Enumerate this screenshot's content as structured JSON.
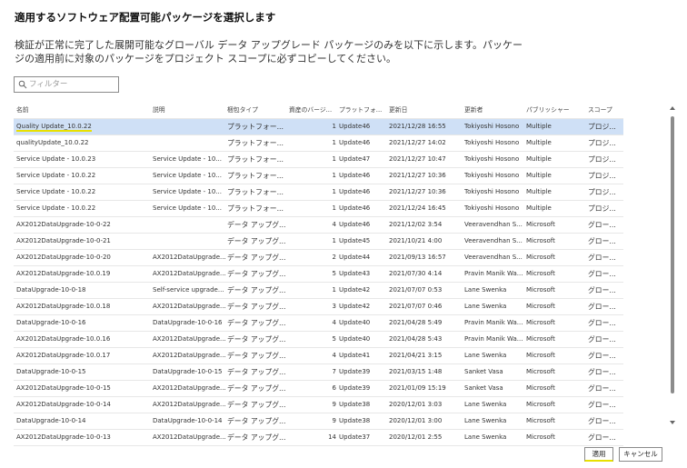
{
  "dialog": {
    "title": "適用するソフトウェア配置可能パッケージを選択します",
    "description": "検証が正常に完了した展開可能なグローバル データ アップグレード パッケージのみを以下に示します。パッケージの適用前に対象のパッケージをプロジェクト スコープに必ずコピーしてください。"
  },
  "filter": {
    "placeholder": "フィルター"
  },
  "table": {
    "headers": {
      "name": "名前",
      "desc": "説明",
      "type": "梱包タイプ",
      "count": "資産のバージ...",
      "platform": "プラットフォ...",
      "updated": "更新日",
      "updated_by": "更新者",
      "publisher": "パブリッシャー",
      "scope": "スコープ"
    },
    "rows": [
      {
        "name": "Quality Update_10.0.22",
        "desc": "",
        "type": "プラットフォー...",
        "count": "1",
        "platform": "Update46",
        "updated": "2021/12/28 16:55",
        "updated_by": "Tokiyoshi Hosono",
        "publisher": "Multiple",
        "scope": "プロジ..."
      },
      {
        "name": "qualityUpdate_10.0.22",
        "desc": "",
        "type": "プラットフォー...",
        "count": "1",
        "platform": "Update46",
        "updated": "2021/12/27 14:02",
        "updated_by": "Tokiyoshi Hosono",
        "publisher": "Multiple",
        "scope": "プロジ..."
      },
      {
        "name": "Service Update - 10.0.23",
        "desc": "Service Update - 10...",
        "type": "プラットフォー...",
        "count": "1",
        "platform": "Update47",
        "updated": "2021/12/27 10:47",
        "updated_by": "Tokiyoshi Hosono",
        "publisher": "Multiple",
        "scope": "プロジ..."
      },
      {
        "name": "Service Update - 10.0.22",
        "desc": "Service Update - 10...",
        "type": "プラットフォー...",
        "count": "1",
        "platform": "Update46",
        "updated": "2021/12/27 10:36",
        "updated_by": "Tokiyoshi Hosono",
        "publisher": "Multiple",
        "scope": "プロジ..."
      },
      {
        "name": "Service Update - 10.0.22",
        "desc": "Service Update - 10...",
        "type": "プラットフォー...",
        "count": "1",
        "platform": "Update46",
        "updated": "2021/12/27 10:36",
        "updated_by": "Tokiyoshi Hosono",
        "publisher": "Multiple",
        "scope": "プロジ..."
      },
      {
        "name": "Service Update - 10.0.22",
        "desc": "Service Update - 10...",
        "type": "プラットフォー...",
        "count": "1",
        "platform": "Update46",
        "updated": "2021/12/24 16:45",
        "updated_by": "Tokiyoshi Hosono",
        "publisher": "Multiple",
        "scope": "プロジ..."
      },
      {
        "name": "AX2012DataUpgrade-10-0-22",
        "desc": "",
        "type": "データ アップグ...",
        "count": "4",
        "platform": "Update46",
        "updated": "2021/12/02 3:54",
        "updated_by": "Veeravendhan S...",
        "publisher": "Microsoft",
        "scope": "グロー..."
      },
      {
        "name": "AX2012DataUpgrade-10-0-21",
        "desc": "",
        "type": "データ アップグ...",
        "count": "1",
        "platform": "Update45",
        "updated": "2021/10/21 4:00",
        "updated_by": "Veeravendhan S...",
        "publisher": "Microsoft",
        "scope": "グロー..."
      },
      {
        "name": "AX2012DataUpgrade-10-0-20",
        "desc": "AX2012DataUpgrade...",
        "type": "データ アップグ...",
        "count": "2",
        "platform": "Update44",
        "updated": "2021/09/13 16:57",
        "updated_by": "Veeravendhan S...",
        "publisher": "Microsoft",
        "scope": "グロー..."
      },
      {
        "name": "AX2012DataUpgrade-10.0.19",
        "desc": "AX2012DataUpgrade...",
        "type": "データ アップグ...",
        "count": "5",
        "platform": "Update43",
        "updated": "2021/07/30 4:14",
        "updated_by": "Pravin Manik Wa...",
        "publisher": "Microsoft",
        "scope": "グロー..."
      },
      {
        "name": "DataUpgrade-10-0-18",
        "desc": "Self-service upgrade...",
        "type": "データ アップグ...",
        "count": "1",
        "platform": "Update42",
        "updated": "2021/07/07 0:53",
        "updated_by": "Lane Swenka",
        "publisher": "Microsoft",
        "scope": "グロー..."
      },
      {
        "name": "AX2012DataUpgrade-10.0.18",
        "desc": "AX2012DataUpgrade...",
        "type": "データ アップグ...",
        "count": "3",
        "platform": "Update42",
        "updated": "2021/07/07 0:46",
        "updated_by": "Lane Swenka",
        "publisher": "Microsoft",
        "scope": "グロー..."
      },
      {
        "name": "DataUpgrade-10-0-16",
        "desc": "DataUpgrade-10-0-16",
        "type": "データ アップグ...",
        "count": "4",
        "platform": "Update40",
        "updated": "2021/04/28 5:49",
        "updated_by": "Pravin Manik Wa...",
        "publisher": "Microsoft",
        "scope": "グロー..."
      },
      {
        "name": "AX2012DataUpgrade-10.0.16",
        "desc": "AX2012DataUpgrade...",
        "type": "データ アップグ...",
        "count": "5",
        "platform": "Update40",
        "updated": "2021/04/28 5:43",
        "updated_by": "Pravin Manik Wa...",
        "publisher": "Microsoft",
        "scope": "グロー..."
      },
      {
        "name": "AX2012DataUpgrade-10.0.17",
        "desc": "AX2012DataUpgrade...",
        "type": "データ アップグ...",
        "count": "4",
        "platform": "Update41",
        "updated": "2021/04/21 3:15",
        "updated_by": "Lane Swenka",
        "publisher": "Microsoft",
        "scope": "グロー..."
      },
      {
        "name": "DataUpgrade-10-0-15",
        "desc": "DataUpgrade-10-0-15",
        "type": "データ アップグ...",
        "count": "7",
        "platform": "Update39",
        "updated": "2021/03/15 1:48",
        "updated_by": "Sanket Vasa",
        "publisher": "Microsoft",
        "scope": "グロー..."
      },
      {
        "name": "AX2012DataUpgrade-10-0-15",
        "desc": "AX2012DataUpgrade...",
        "type": "データ アップグ...",
        "count": "6",
        "platform": "Update39",
        "updated": "2021/01/09 15:19",
        "updated_by": "Sanket Vasa",
        "publisher": "Microsoft",
        "scope": "グロー..."
      },
      {
        "name": "AX2012DataUpgrade-10-0-14",
        "desc": "AX2012DataUpgrade...",
        "type": "データ アップグ...",
        "count": "9",
        "platform": "Update38",
        "updated": "2020/12/01 3:03",
        "updated_by": "Lane Swenka",
        "publisher": "Microsoft",
        "scope": "グロー..."
      },
      {
        "name": "DataUpgrade-10-0-14",
        "desc": "DataUpgrade-10-0-14",
        "type": "データ アップグ...",
        "count": "9",
        "platform": "Update38",
        "updated": "2020/12/01 3:00",
        "updated_by": "Lane Swenka",
        "publisher": "Microsoft",
        "scope": "グロー..."
      },
      {
        "name": "AX2012DataUpgrade-10-0-13",
        "desc": "AX2012DataUpgrade...",
        "type": "データ アップグ...",
        "count": "14",
        "platform": "Update37",
        "updated": "2020/12/01 2:55",
        "updated_by": "Lane Swenka",
        "publisher": "Microsoft",
        "scope": "グロー..."
      }
    ]
  },
  "buttons": {
    "apply": "適用",
    "cancel": "キャンセル"
  },
  "colors": {
    "selected_row": "#cfe0f6",
    "highlight": "#e8e000"
  }
}
